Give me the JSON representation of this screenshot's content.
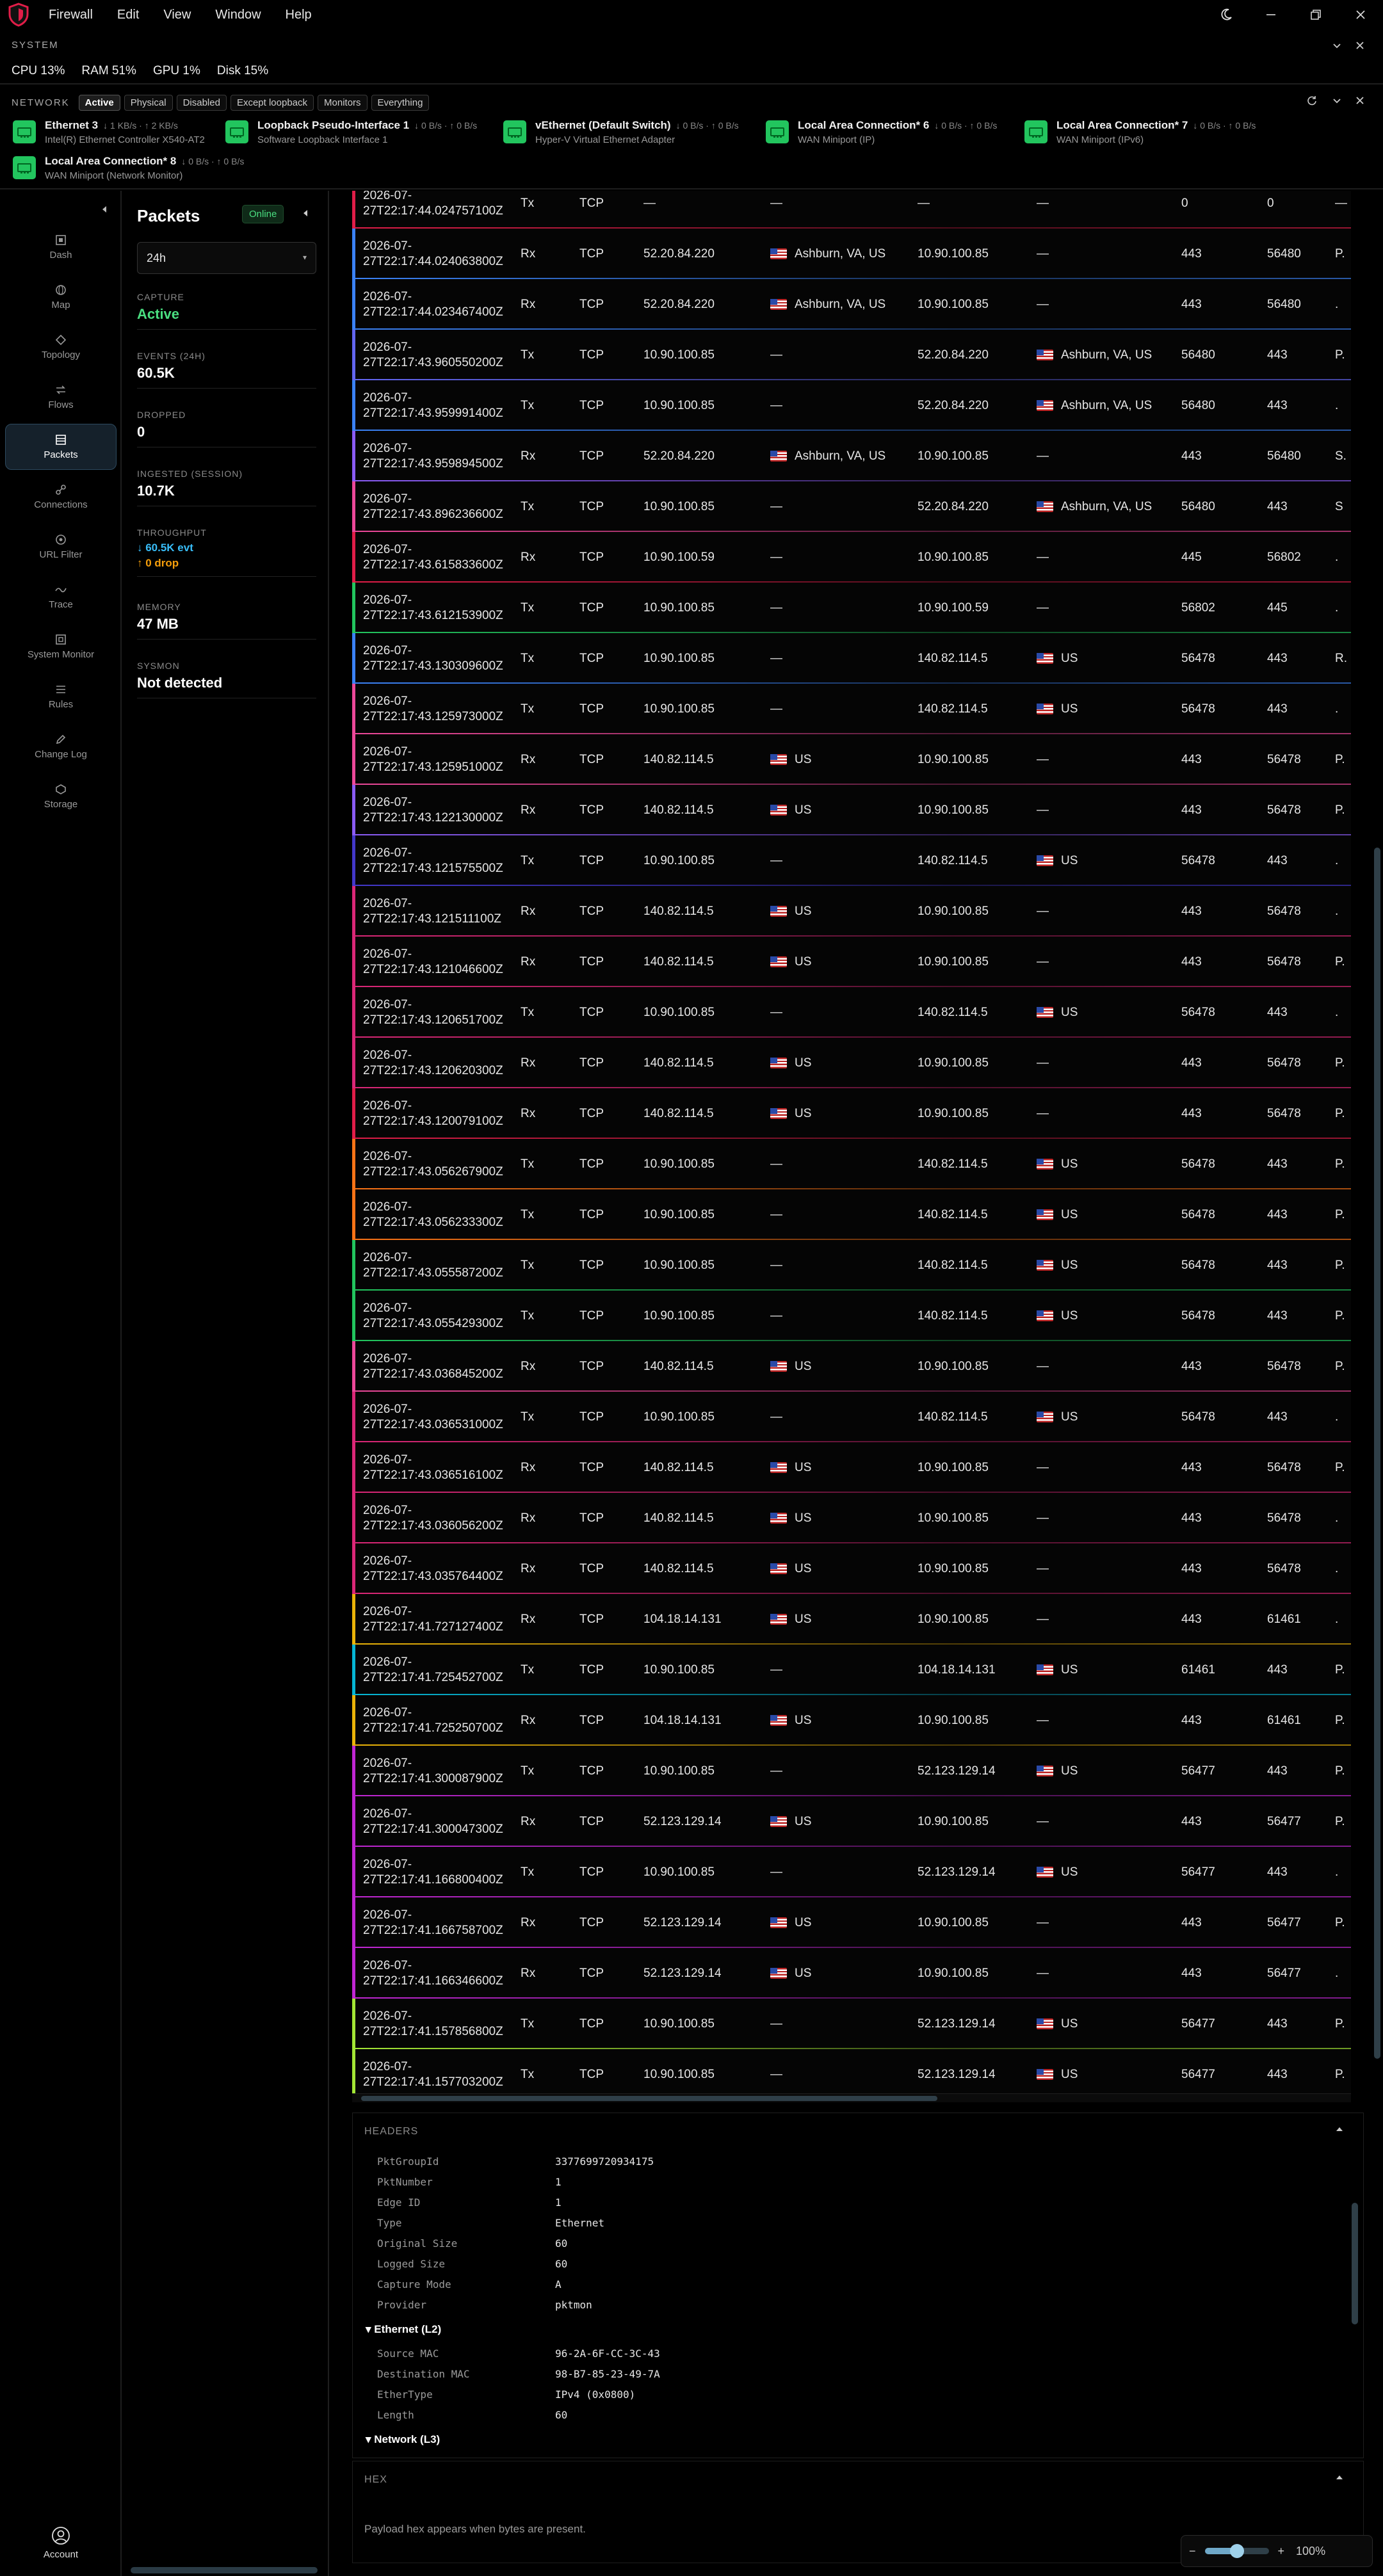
{
  "menu": [
    "Firewall",
    "Edit",
    "View",
    "Window",
    "Help"
  ],
  "system": {
    "title": "SYSTEM",
    "metrics": [
      "CPU 13%",
      "RAM 51%",
      "GPU 1%",
      "Disk 15%"
    ]
  },
  "network": {
    "title": "NETWORK",
    "filters": [
      "Active",
      "Physical",
      "Disabled",
      "Except loopback",
      "Monitors",
      "Everything"
    ],
    "active_filter": "Active",
    "adapters": [
      {
        "name": "Ethernet 3",
        "rate": "↓ 1 KB/s · ↑ 2 KB/s",
        "desc": "Intel(R) Ethernet Controller X540-AT2"
      },
      {
        "name": "Loopback Pseudo-Interface 1",
        "rate": "↓ 0 B/s · ↑ 0 B/s",
        "desc": "Software Loopback Interface 1"
      },
      {
        "name": "vEthernet (Default Switch)",
        "rate": "↓ 0 B/s · ↑ 0 B/s",
        "desc": "Hyper-V Virtual Ethernet Adapter"
      },
      {
        "name": "Local Area Connection* 6",
        "rate": "↓ 0 B/s · ↑ 0 B/s",
        "desc": "WAN Miniport (IP)"
      },
      {
        "name": "Local Area Connection* 7",
        "rate": "↓ 0 B/s · ↑ 0 B/s",
        "desc": "WAN Miniport (IPv6)"
      },
      {
        "name": "Local Area Connection* 8",
        "rate": "↓ 0 B/s · ↑ 0 B/s",
        "desc": "WAN Miniport (Network Monitor)"
      }
    ]
  },
  "nav": {
    "items": [
      "Dash",
      "Map",
      "Topology",
      "Flows",
      "Packets",
      "Connections",
      "URL Filter",
      "Trace",
      "System Monitor",
      "Rules",
      "Change Log",
      "Storage"
    ],
    "active": "Packets",
    "account": "Account"
  },
  "panel": {
    "title": "Packets",
    "status": "Online",
    "range": "24h",
    "stats": {
      "capture_label": "CAPTURE",
      "capture_value": "Active",
      "events_label": "EVENTS (24H)",
      "events_value": "60.5K",
      "dropped_label": "DROPPED",
      "dropped_value": "0",
      "ingested_label": "INGESTED (SESSION)",
      "ingested_value": "10.7K",
      "throughput_label": "THROUGHPUT",
      "throughput_evt": "↓ 60.5K evt",
      "throughput_drop": "↑ 0 drop",
      "memory_label": "MEMORY",
      "memory_value": "47 MB",
      "sysmon_label": "SYSMON",
      "sysmon_value": "Not detected"
    }
  },
  "packets": {
    "rows": [
      {
        "ts1": "2026-07-",
        "ts2": "27T22:17:44.024757100Z",
        "dir": "Tx",
        "proto": "TCP",
        "src": "—",
        "src_geo": "—",
        "src_flag": false,
        "dst": "—",
        "dst_geo": "—",
        "dst_flag": false,
        "sport": "0",
        "dport": "0",
        "flag": "—",
        "color": "#e11d48"
      },
      {
        "ts1": "2026-07-",
        "ts2": "27T22:17:44.024063800Z",
        "dir": "Rx",
        "proto": "TCP",
        "src": "52.20.84.220",
        "src_geo": "Ashburn, VA, US",
        "src_flag": true,
        "dst": "10.90.100.85",
        "dst_geo": "—",
        "dst_flag": false,
        "sport": "443",
        "dport": "56480",
        "flag": "P.",
        "color": "#3b82f6"
      },
      {
        "ts1": "2026-07-",
        "ts2": "27T22:17:44.023467400Z",
        "dir": "Rx",
        "proto": "TCP",
        "src": "52.20.84.220",
        "src_geo": "Ashburn, VA, US",
        "src_flag": true,
        "dst": "10.90.100.85",
        "dst_geo": "—",
        "dst_flag": false,
        "sport": "443",
        "dport": "56480",
        "flag": ".",
        "color": "#3b82f6"
      },
      {
        "ts1": "2026-07-",
        "ts2": "27T22:17:43.960550200Z",
        "dir": "Tx",
        "proto": "TCP",
        "src": "10.90.100.85",
        "src_geo": "—",
        "src_flag": false,
        "dst": "52.20.84.220",
        "dst_geo": "Ashburn, VA, US",
        "dst_flag": true,
        "sport": "56480",
        "dport": "443",
        "flag": "P.",
        "color": "#6366f1"
      },
      {
        "ts1": "2026-07-",
        "ts2": "27T22:17:43.959991400Z",
        "dir": "Tx",
        "proto": "TCP",
        "src": "10.90.100.85",
        "src_geo": "—",
        "src_flag": false,
        "dst": "52.20.84.220",
        "dst_geo": "Ashburn, VA, US",
        "dst_flag": true,
        "sport": "56480",
        "dport": "443",
        "flag": ".",
        "color": "#3b82f6"
      },
      {
        "ts1": "2026-07-",
        "ts2": "27T22:17:43.959894500Z",
        "dir": "Rx",
        "proto": "TCP",
        "src": "52.20.84.220",
        "src_geo": "Ashburn, VA, US",
        "src_flag": true,
        "dst": "10.90.100.85",
        "dst_geo": "—",
        "dst_flag": false,
        "sport": "443",
        "dport": "56480",
        "flag": "S.",
        "color": "#8b5cf6"
      },
      {
        "ts1": "2026-07-",
        "ts2": "27T22:17:43.896236600Z",
        "dir": "Tx",
        "proto": "TCP",
        "src": "10.90.100.85",
        "src_geo": "—",
        "src_flag": false,
        "dst": "52.20.84.220",
        "dst_geo": "Ashburn, VA, US",
        "dst_flag": true,
        "sport": "56480",
        "dport": "443",
        "flag": "S",
        "color": "#ec4899"
      },
      {
        "ts1": "2026-07-",
        "ts2": "27T22:17:43.615833600Z",
        "dir": "Rx",
        "proto": "TCP",
        "src": "10.90.100.59",
        "src_geo": "—",
        "src_flag": false,
        "dst": "10.90.100.85",
        "dst_geo": "—",
        "dst_flag": false,
        "sport": "445",
        "dport": "56802",
        "flag": ".",
        "color": "#e11d48"
      },
      {
        "ts1": "2026-07-",
        "ts2": "27T22:17:43.612153900Z",
        "dir": "Tx",
        "proto": "TCP",
        "src": "10.90.100.85",
        "src_geo": "—",
        "src_flag": false,
        "dst": "10.90.100.59",
        "dst_geo": "—",
        "dst_flag": false,
        "sport": "56802",
        "dport": "445",
        "flag": ".",
        "color": "#22c55e"
      },
      {
        "ts1": "2026-07-",
        "ts2": "27T22:17:43.130309600Z",
        "dir": "Tx",
        "proto": "TCP",
        "src": "10.90.100.85",
        "src_geo": "—",
        "src_flag": false,
        "dst": "140.82.114.5",
        "dst_geo": "US",
        "dst_flag": true,
        "sport": "56478",
        "dport": "443",
        "flag": "R.",
        "color": "#3b82f6"
      },
      {
        "ts1": "2026-07-",
        "ts2": "27T22:17:43.125973000Z",
        "dir": "Tx",
        "proto": "TCP",
        "src": "10.90.100.85",
        "src_geo": "—",
        "src_flag": false,
        "dst": "140.82.114.5",
        "dst_geo": "US",
        "dst_flag": true,
        "sport": "56478",
        "dport": "443",
        "flag": ".",
        "color": "#ec4899"
      },
      {
        "ts1": "2026-07-",
        "ts2": "27T22:17:43.125951000Z",
        "dir": "Rx",
        "proto": "TCP",
        "src": "140.82.114.5",
        "src_geo": "US",
        "src_flag": true,
        "dst": "10.90.100.85",
        "dst_geo": "—",
        "dst_flag": false,
        "sport": "443",
        "dport": "56478",
        "flag": "P.",
        "color": "#ec4899"
      },
      {
        "ts1": "2026-07-",
        "ts2": "27T22:17:43.122130000Z",
        "dir": "Rx",
        "proto": "TCP",
        "src": "140.82.114.5",
        "src_geo": "US",
        "src_flag": true,
        "dst": "10.90.100.85",
        "dst_geo": "—",
        "dst_flag": false,
        "sport": "443",
        "dport": "56478",
        "flag": "P.",
        "color": "#8b5cf6"
      },
      {
        "ts1": "2026-07-",
        "ts2": "27T22:17:43.121575500Z",
        "dir": "Tx",
        "proto": "TCP",
        "src": "10.90.100.85",
        "src_geo": "—",
        "src_flag": false,
        "dst": "140.82.114.5",
        "dst_geo": "US",
        "dst_flag": true,
        "sport": "56478",
        "dport": "443",
        "flag": ".",
        "color": "#4338ca"
      },
      {
        "ts1": "2026-07-",
        "ts2": "27T22:17:43.121511100Z",
        "dir": "Rx",
        "proto": "TCP",
        "src": "140.82.114.5",
        "src_geo": "US",
        "src_flag": true,
        "dst": "10.90.100.85",
        "dst_geo": "—",
        "dst_flag": false,
        "sport": "443",
        "dport": "56478",
        "flag": ".",
        "color": "#db2777"
      },
      {
        "ts1": "2026-07-",
        "ts2": "27T22:17:43.121046600Z",
        "dir": "Rx",
        "proto": "TCP",
        "src": "140.82.114.5",
        "src_geo": "US",
        "src_flag": true,
        "dst": "10.90.100.85",
        "dst_geo": "—",
        "dst_flag": false,
        "sport": "443",
        "dport": "56478",
        "flag": "P.",
        "color": "#db2777"
      },
      {
        "ts1": "2026-07-",
        "ts2": "27T22:17:43.120651700Z",
        "dir": "Tx",
        "proto": "TCP",
        "src": "10.90.100.85",
        "src_geo": "—",
        "src_flag": false,
        "dst": "140.82.114.5",
        "dst_geo": "US",
        "dst_flag": true,
        "sport": "56478",
        "dport": "443",
        "flag": ".",
        "color": "#db2777"
      },
      {
        "ts1": "2026-07-",
        "ts2": "27T22:17:43.120620300Z",
        "dir": "Rx",
        "proto": "TCP",
        "src": "140.82.114.5",
        "src_geo": "US",
        "src_flag": true,
        "dst": "10.90.100.85",
        "dst_geo": "—",
        "dst_flag": false,
        "sport": "443",
        "dport": "56478",
        "flag": "P.",
        "color": "#db2777"
      },
      {
        "ts1": "2026-07-",
        "ts2": "27T22:17:43.120079100Z",
        "dir": "Rx",
        "proto": "TCP",
        "src": "140.82.114.5",
        "src_geo": "US",
        "src_flag": true,
        "dst": "10.90.100.85",
        "dst_geo": "—",
        "dst_flag": false,
        "sport": "443",
        "dport": "56478",
        "flag": "P.",
        "color": "#e11d48"
      },
      {
        "ts1": "2026-07-",
        "ts2": "27T22:17:43.056267900Z",
        "dir": "Tx",
        "proto": "TCP",
        "src": "10.90.100.85",
        "src_geo": "—",
        "src_flag": false,
        "dst": "140.82.114.5",
        "dst_geo": "US",
        "dst_flag": true,
        "sport": "56478",
        "dport": "443",
        "flag": "P.",
        "color": "#f97316"
      },
      {
        "ts1": "2026-07-",
        "ts2": "27T22:17:43.056233300Z",
        "dir": "Tx",
        "proto": "TCP",
        "src": "10.90.100.85",
        "src_geo": "—",
        "src_flag": false,
        "dst": "140.82.114.5",
        "dst_geo": "US",
        "dst_flag": true,
        "sport": "56478",
        "dport": "443",
        "flag": "P.",
        "color": "#f97316"
      },
      {
        "ts1": "2026-07-",
        "ts2": "27T22:17:43.055587200Z",
        "dir": "Tx",
        "proto": "TCP",
        "src": "10.90.100.85",
        "src_geo": "—",
        "src_flag": false,
        "dst": "140.82.114.5",
        "dst_geo": "US",
        "dst_flag": true,
        "sport": "56478",
        "dport": "443",
        "flag": "P.",
        "color": "#22c55e"
      },
      {
        "ts1": "2026-07-",
        "ts2": "27T22:17:43.055429300Z",
        "dir": "Tx",
        "proto": "TCP",
        "src": "10.90.100.85",
        "src_geo": "—",
        "src_flag": false,
        "dst": "140.82.114.5",
        "dst_geo": "US",
        "dst_flag": true,
        "sport": "56478",
        "dport": "443",
        "flag": "P.",
        "color": "#22c55e"
      },
      {
        "ts1": "2026-07-",
        "ts2": "27T22:17:43.036845200Z",
        "dir": "Rx",
        "proto": "TCP",
        "src": "140.82.114.5",
        "src_geo": "US",
        "src_flag": true,
        "dst": "10.90.100.85",
        "dst_geo": "—",
        "dst_flag": false,
        "sport": "443",
        "dport": "56478",
        "flag": "P.",
        "color": "#ec4899"
      },
      {
        "ts1": "2026-07-",
        "ts2": "27T22:17:43.036531000Z",
        "dir": "Tx",
        "proto": "TCP",
        "src": "10.90.100.85",
        "src_geo": "—",
        "src_flag": false,
        "dst": "140.82.114.5",
        "dst_geo": "US",
        "dst_flag": true,
        "sport": "56478",
        "dport": "443",
        "flag": ".",
        "color": "#db2777"
      },
      {
        "ts1": "2026-07-",
        "ts2": "27T22:17:43.036516100Z",
        "dir": "Rx",
        "proto": "TCP",
        "src": "140.82.114.5",
        "src_geo": "US",
        "src_flag": true,
        "dst": "10.90.100.85",
        "dst_geo": "—",
        "dst_flag": false,
        "sport": "443",
        "dport": "56478",
        "flag": "P.",
        "color": "#db2777"
      },
      {
        "ts1": "2026-07-",
        "ts2": "27T22:17:43.036056200Z",
        "dir": "Rx",
        "proto": "TCP",
        "src": "140.82.114.5",
        "src_geo": "US",
        "src_flag": true,
        "dst": "10.90.100.85",
        "dst_geo": "—",
        "dst_flag": false,
        "sport": "443",
        "dport": "56478",
        "flag": ".",
        "color": "#db2777"
      },
      {
        "ts1": "2026-07-",
        "ts2": "27T22:17:43.035764400Z",
        "dir": "Rx",
        "proto": "TCP",
        "src": "140.82.114.5",
        "src_geo": "US",
        "src_flag": true,
        "dst": "10.90.100.85",
        "dst_geo": "—",
        "dst_flag": false,
        "sport": "443",
        "dport": "56478",
        "flag": ".",
        "color": "#db2777"
      },
      {
        "ts1": "2026-07-",
        "ts2": "27T22:17:41.727127400Z",
        "dir": "Rx",
        "proto": "TCP",
        "src": "104.18.14.131",
        "src_geo": "US",
        "src_flag": true,
        "dst": "10.90.100.85",
        "dst_geo": "—",
        "dst_flag": false,
        "sport": "443",
        "dport": "61461",
        "flag": ".",
        "color": "#eab308"
      },
      {
        "ts1": "2026-07-",
        "ts2": "27T22:17:41.725452700Z",
        "dir": "Tx",
        "proto": "TCP",
        "src": "10.90.100.85",
        "src_geo": "—",
        "src_flag": false,
        "dst": "104.18.14.131",
        "dst_geo": "US",
        "dst_flag": true,
        "sport": "61461",
        "dport": "443",
        "flag": "P.",
        "color": "#06b6d4"
      },
      {
        "ts1": "2026-07-",
        "ts2": "27T22:17:41.725250700Z",
        "dir": "Rx",
        "proto": "TCP",
        "src": "104.18.14.131",
        "src_geo": "US",
        "src_flag": true,
        "dst": "10.90.100.85",
        "dst_geo": "—",
        "dst_flag": false,
        "sport": "443",
        "dport": "61461",
        "flag": "P.",
        "color": "#eab308"
      },
      {
        "ts1": "2026-07-",
        "ts2": "27T22:17:41.300087900Z",
        "dir": "Tx",
        "proto": "TCP",
        "src": "10.90.100.85",
        "src_geo": "—",
        "src_flag": false,
        "dst": "52.123.129.14",
        "dst_geo": "US",
        "dst_flag": true,
        "sport": "56477",
        "dport": "443",
        "flag": "P.",
        "color": "#c026d3"
      },
      {
        "ts1": "2026-07-",
        "ts2": "27T22:17:41.300047300Z",
        "dir": "Rx",
        "proto": "TCP",
        "src": "52.123.129.14",
        "src_geo": "US",
        "src_flag": true,
        "dst": "10.90.100.85",
        "dst_geo": "—",
        "dst_flag": false,
        "sport": "443",
        "dport": "56477",
        "flag": "P.",
        "color": "#c026d3"
      },
      {
        "ts1": "2026-07-",
        "ts2": "27T22:17:41.166800400Z",
        "dir": "Tx",
        "proto": "TCP",
        "src": "10.90.100.85",
        "src_geo": "—",
        "src_flag": false,
        "dst": "52.123.129.14",
        "dst_geo": "US",
        "dst_flag": true,
        "sport": "56477",
        "dport": "443",
        "flag": ".",
        "color": "#c026d3"
      },
      {
        "ts1": "2026-07-",
        "ts2": "27T22:17:41.166758700Z",
        "dir": "Rx",
        "proto": "TCP",
        "src": "52.123.129.14",
        "src_geo": "US",
        "src_flag": true,
        "dst": "10.90.100.85",
        "dst_geo": "—",
        "dst_flag": false,
        "sport": "443",
        "dport": "56477",
        "flag": "P.",
        "color": "#c026d3"
      },
      {
        "ts1": "2026-07-",
        "ts2": "27T22:17:41.166346600Z",
        "dir": "Rx",
        "proto": "TCP",
        "src": "52.123.129.14",
        "src_geo": "US",
        "src_flag": true,
        "dst": "10.90.100.85",
        "dst_geo": "—",
        "dst_flag": false,
        "sport": "443",
        "dport": "56477",
        "flag": ".",
        "color": "#c026d3"
      },
      {
        "ts1": "2026-07-",
        "ts2": "27T22:17:41.157856800Z",
        "dir": "Tx",
        "proto": "TCP",
        "src": "10.90.100.85",
        "src_geo": "—",
        "src_flag": false,
        "dst": "52.123.129.14",
        "dst_geo": "US",
        "dst_flag": true,
        "sport": "56477",
        "dport": "443",
        "flag": "P.",
        "color": "#a3e635"
      },
      {
        "ts1": "2026-07-",
        "ts2": "27T22:17:41.157703200Z",
        "dir": "Tx",
        "proto": "TCP",
        "src": "10.90.100.85",
        "src_geo": "—",
        "src_flag": false,
        "dst": "52.123.129.14",
        "dst_geo": "US",
        "dst_flag": true,
        "sport": "56477",
        "dport": "443",
        "flag": "P.",
        "color": "#a3e635"
      }
    ]
  },
  "headers": {
    "title": "HEADERS",
    "frame": [
      {
        "k": "PktGroupId",
        "v": "3377699720934175"
      },
      {
        "k": "PktNumber",
        "v": "1"
      },
      {
        "k": "Edge ID",
        "v": "1"
      },
      {
        "k": "Type",
        "v": "Ethernet"
      },
      {
        "k": "Original Size",
        "v": "60"
      },
      {
        "k": "Logged Size",
        "v": "60"
      },
      {
        "k": "Capture Mode",
        "v": "A"
      },
      {
        "k": "Provider",
        "v": "pktmon"
      }
    ],
    "l2_title": "Ethernet (L2)",
    "l2": [
      {
        "k": "Source MAC",
        "v": "96-2A-6F-CC-3C-43"
      },
      {
        "k": "Destination MAC",
        "v": "98-B7-85-23-49-7A"
      },
      {
        "k": "EtherType",
        "v": "IPv4 (0x0800)"
      },
      {
        "k": "Length",
        "v": "60"
      }
    ],
    "l3_title": "Network (L3)"
  },
  "hex": {
    "title": "HEX",
    "note": "Payload hex appears when bytes are present."
  },
  "zoom": {
    "minus": "−",
    "plus": "+",
    "value": "100%",
    "level": 0.5
  },
  "colors": {
    "accent": "#22c55e",
    "active": "#4ade80",
    "drop": "#f59e0b",
    "evt": "#38bdf8"
  }
}
